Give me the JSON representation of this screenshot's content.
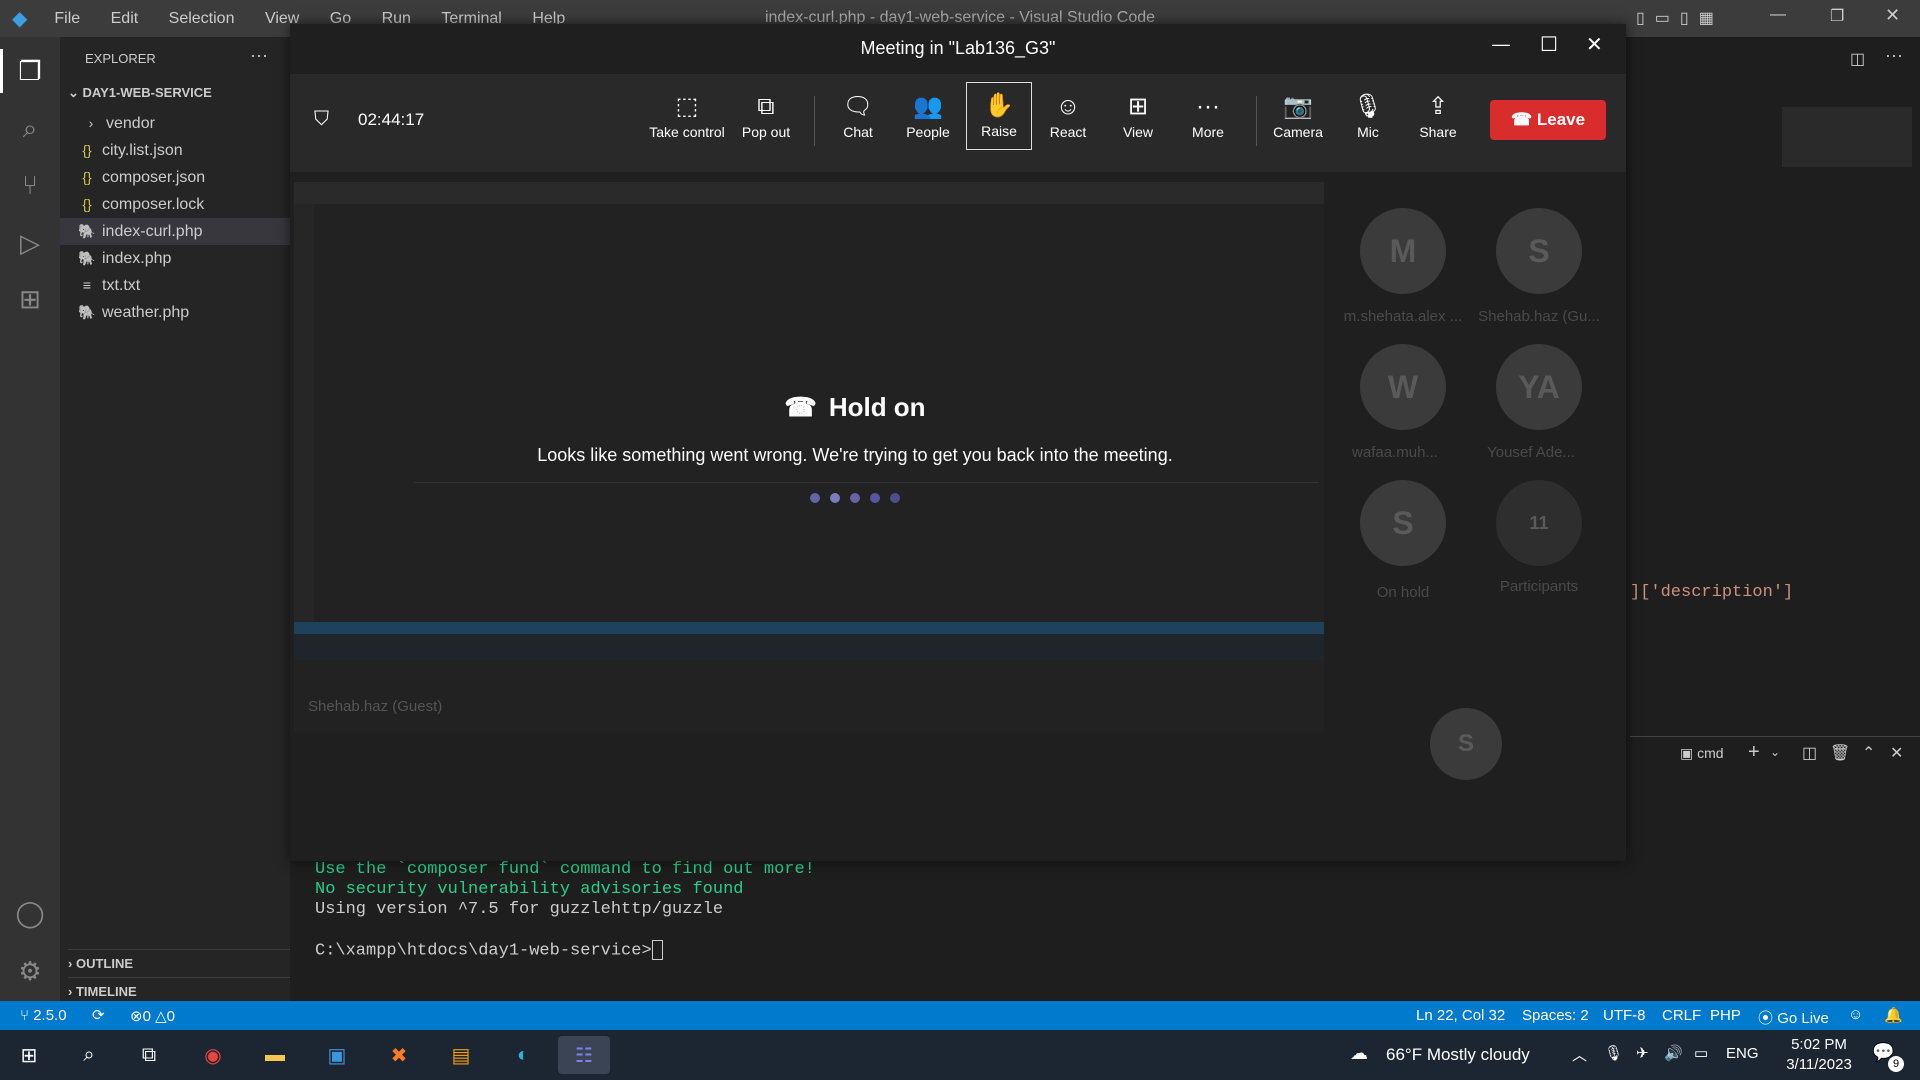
{
  "vscode": {
    "menu": [
      "File",
      "Edit",
      "Selection",
      "View",
      "Go",
      "Run",
      "Terminal",
      "Help"
    ],
    "window_title": "index-curl.php - day1-web-service - Visual Studio Code"
  },
  "sidebar": {
    "header": "EXPLORER",
    "root": "DAY1-WEB-SERVICE",
    "items": [
      {
        "label": "vendor",
        "icon": "chevron-right"
      },
      {
        "label": "city.list.json",
        "icon": "{}"
      },
      {
        "label": "composer.json",
        "icon": "{}"
      },
      {
        "label": "composer.lock",
        "icon": "{}"
      },
      {
        "label": "index-curl.php",
        "icon": "php"
      },
      {
        "label": "index.php",
        "icon": "php"
      },
      {
        "label": "txt.txt",
        "icon": "≡"
      },
      {
        "label": "weather.php",
        "icon": "php"
      }
    ],
    "outline": "OUTLINE",
    "timeline": "TIMELINE"
  },
  "editor": {
    "snippet": "]['description']"
  },
  "terminal": {
    "shell": "cmd",
    "lines": [
      "Use the `composer fund` command to find out more!",
      "No security vulnerability advisories found",
      "Using version ^7.5 for guzzlehttp/guzzle"
    ],
    "prompt": "C:\\xampp\\htdocs\\day1-web-service>"
  },
  "statusbar": {
    "branch": "2.5.0",
    "errors": "0",
    "warnings": "0",
    "position": "Ln 22, Col 32",
    "spaces": "Spaces: 2",
    "encoding": "UTF-8",
    "eol": "CRLF",
    "language": "PHP",
    "golive": "Go Live"
  },
  "teams": {
    "title": "Meeting in \"Lab136_G3\"",
    "timer": "02:44:17",
    "toolbar": {
      "take_control": "Take control",
      "pop_out": "Pop out",
      "chat": "Chat",
      "people": "People",
      "raise": "Raise",
      "react": "React",
      "view": "View",
      "more": "More",
      "camera": "Camera",
      "mic": "Mic",
      "share": "Share",
      "leave": "Leave"
    },
    "hold_title": "Hold on",
    "hold_message": "Looks like something went wrong. We're trying to get you back into the meeting.",
    "presenter": "Shehab.haz (Guest)",
    "participants": [
      {
        "initials": "M",
        "name": "m.shehata.alex ..."
      },
      {
        "initials": "S",
        "name": "Shehab.haz (Gu..."
      },
      {
        "initials": "W",
        "name": "wafaa.muh..."
      },
      {
        "initials": "YA",
        "name": "Yousef Ade..."
      },
      {
        "initials": "S",
        "name": "On hold"
      },
      {
        "initials": "11",
        "name": "Participants"
      }
    ],
    "self_initials": "S"
  },
  "taskbar": {
    "weather": "66°F  Mostly cloudy",
    "lang": "ENG",
    "time": "5:02 PM",
    "date": "3/11/2023",
    "notifications": "9"
  },
  "colors": {
    "leave": "#d92c2c",
    "statusbar": "#007acc",
    "dots": "#6264a7",
    "terminal_green": "#23d18b"
  }
}
